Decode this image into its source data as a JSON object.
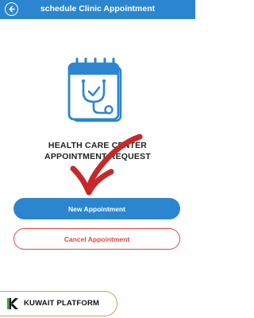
{
  "header": {
    "title": "schedule Clinic Appointment",
    "back_icon": "back-arrow-icon",
    "background_color": "#2b86cf"
  },
  "illustration": {
    "icon": "calendar-stethoscope-icon",
    "color": "#2b86cf"
  },
  "heading": {
    "line1": "HEALTH CARE CENTER",
    "line2": "APPOINTMENT REQUEST"
  },
  "actions": {
    "new_label": "New Appointment",
    "cancel_label": "Cancel Appointment",
    "accent_color": "#2b86cf",
    "cancel_color": "#e4453f"
  },
  "overlay": {
    "icon": "red-arrow-annotation-icon",
    "color": "#c8272a"
  },
  "watermark": {
    "brand": "KUWAIT PLATFORM",
    "icon": "kuwait-platform-logo-icon"
  }
}
